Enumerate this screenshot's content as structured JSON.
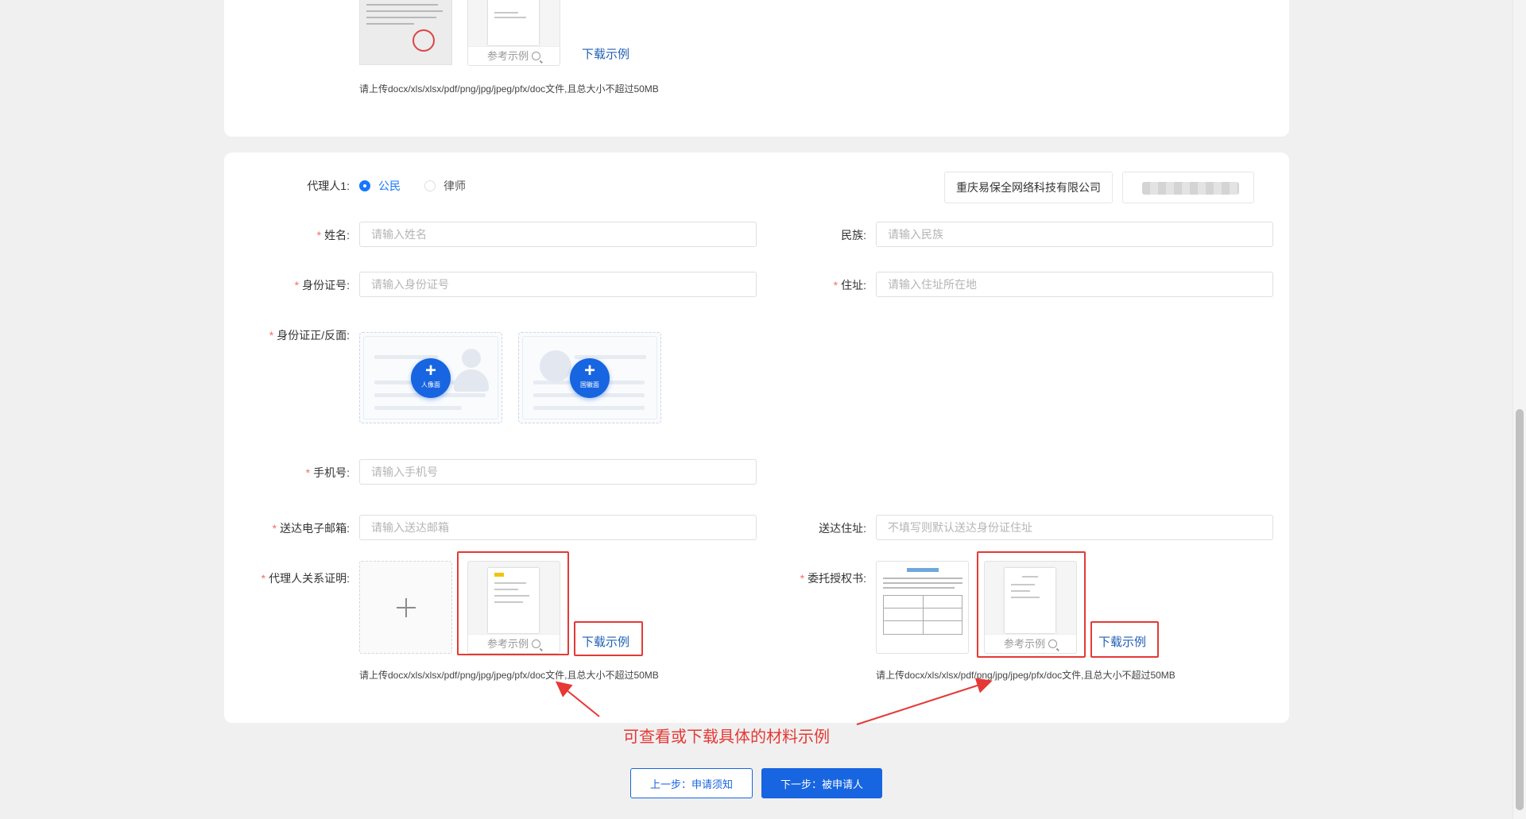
{
  "top_section": {
    "ref_example": "参考示例",
    "download_example": "下载示例",
    "hint": "请上传docx/xls/xlsx/pdf/png/jpg/jpeg/pfx/doc文件,且总大小不超过50MB"
  },
  "agent": {
    "label": "代理人1:",
    "type_options": [
      "公民",
      "律师"
    ],
    "selected_type": "公民",
    "company_chip": "重庆易保全网络科技有限公司"
  },
  "fields": {
    "name": {
      "label": "姓名:",
      "placeholder": "请输入姓名",
      "required": true
    },
    "ethnicity": {
      "label": "民族:",
      "placeholder": "请输入民族",
      "required": false
    },
    "id_number": {
      "label": "身份证号:",
      "placeholder": "请输入身份证号",
      "required": true
    },
    "address": {
      "label": "住址:",
      "placeholder": "请输入住址所在地",
      "required": true
    },
    "id_photos": {
      "label": "身份证正/反面:",
      "required": true,
      "front_text": "人像面",
      "back_text": "国徽面"
    },
    "phone": {
      "label": "手机号:",
      "placeholder": "请输入手机号",
      "required": true
    },
    "email": {
      "label": "送达电子邮箱:",
      "placeholder": "请输入送达邮箱",
      "required": true
    },
    "delivery_address": {
      "label": "送达住址:",
      "placeholder": "不填写则默认送达身份证住址",
      "required": false
    },
    "relation_proof": {
      "label": "代理人关系证明:",
      "required": true
    },
    "authorization": {
      "label": "委托授权书:",
      "required": true
    }
  },
  "uploads": {
    "ref_example": "参考示例",
    "download_example": "下载示例",
    "hint": "请上传docx/xls/xlsx/pdf/png/jpg/jpeg/pfx/doc文件,且总大小不超过50MB"
  },
  "annotation": "可查看或下载具体的材料示例",
  "buttons": {
    "prev": "上一步：申请须知",
    "next": "下一步：被申请人"
  },
  "colors": {
    "primary": "#1765e0",
    "required": "#f56c6c",
    "annotation": "#e53935",
    "link": "#1f5fb5"
  }
}
